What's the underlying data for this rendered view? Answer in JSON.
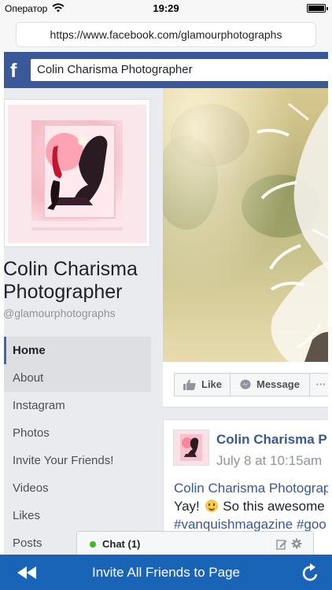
{
  "status_bar": {
    "carrier": "Оператор",
    "time": "19:29"
  },
  "browser": {
    "url": "https://www.facebook.com/glamourphotographs"
  },
  "facebook": {
    "search_value": "Colin Charisma Photographer",
    "logo_letter": "f",
    "brand_color": "#3b5998"
  },
  "page": {
    "name_line1": "Colin Charisma",
    "name_line2": "Photographer",
    "handle": "@glamourphotographs"
  },
  "nav": {
    "items": [
      {
        "label": "Home"
      },
      {
        "label": "About"
      },
      {
        "label": "Instagram"
      },
      {
        "label": "Photos"
      },
      {
        "label": "Invite Your Friends!"
      },
      {
        "label": "Videos"
      },
      {
        "label": "Likes"
      },
      {
        "label": "Posts"
      }
    ]
  },
  "actions": {
    "like": "Like",
    "message": "Message",
    "more": "···"
  },
  "post": {
    "author": "Colin Charisma P",
    "time": "July 8 at 10:15am",
    "line1": "Colin Charisma Photograp",
    "line2_before": "Yay!",
    "line2_after": "So this awesome",
    "line3": "#vanquishmagazine #goo"
  },
  "chat": {
    "label": "Chat (1)",
    "online_color": "#42b72a"
  },
  "bottom_bar": {
    "label": "Invite All Friends to Page",
    "color": "#1a64b8"
  },
  "icons": {
    "wifi": "wifi-icon",
    "battery": "battery-icon",
    "like": "thumbs-up-icon",
    "message": "messenger-icon",
    "compose": "compose-icon",
    "settings": "gear-icon",
    "rewind": "rewind-icon",
    "refresh": "refresh-icon"
  }
}
